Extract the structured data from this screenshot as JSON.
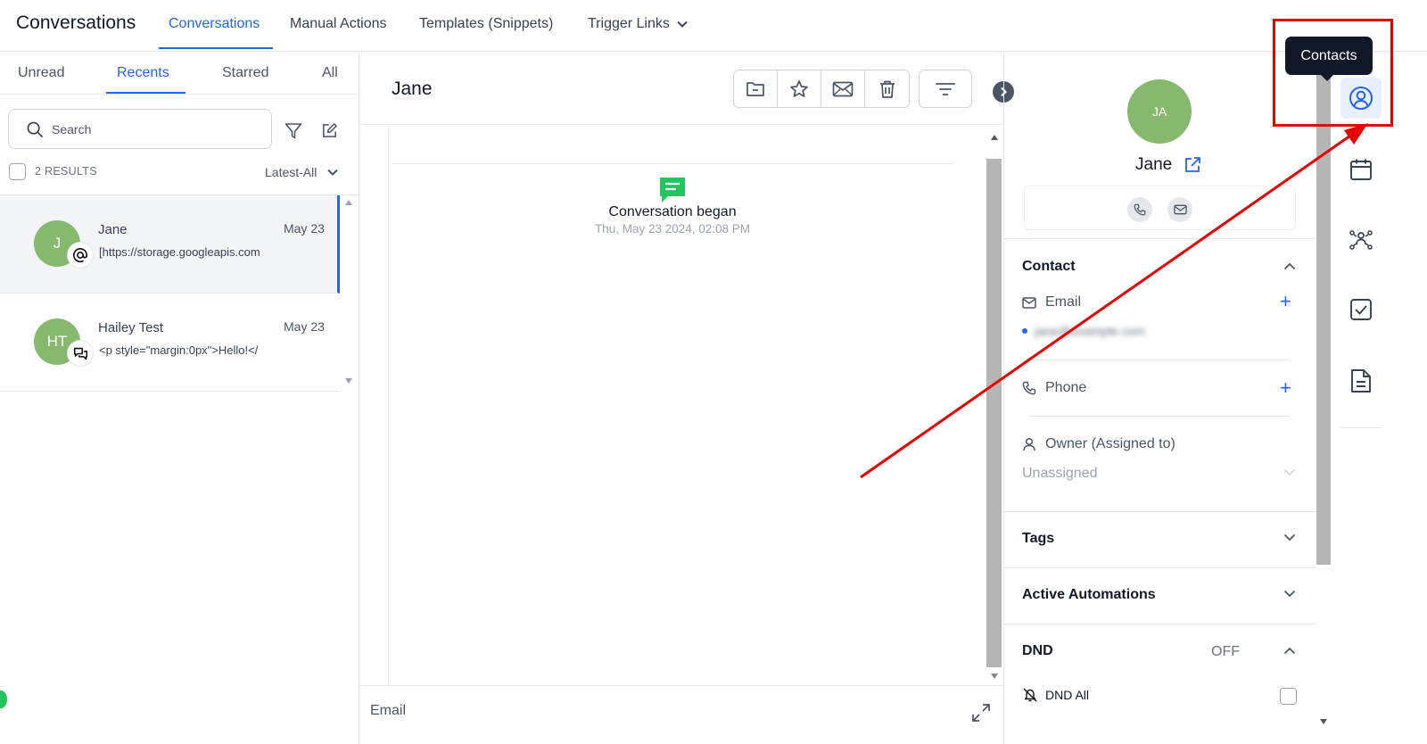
{
  "app": {
    "title": "Conversations"
  },
  "topnav": {
    "items": [
      {
        "label": "Conversations"
      },
      {
        "label": "Manual Actions"
      },
      {
        "label": "Templates (Snippets)"
      },
      {
        "label": "Trigger Links"
      }
    ]
  },
  "left": {
    "tabs": [
      {
        "label": "Unread"
      },
      {
        "label": "Recents"
      },
      {
        "label": "Starred"
      },
      {
        "label": "All"
      }
    ],
    "search": {
      "placeholder": "Search"
    },
    "results_count": "2 RESULTS",
    "sort": {
      "label": "Latest-All"
    },
    "conversations": [
      {
        "initials": "J",
        "name": "Jane",
        "preview": "[https://storage.googleapis.com",
        "date": "May 23",
        "channel_icon": "at-sign-icon"
      },
      {
        "initials": "HT",
        "name": "Hailey Test",
        "preview": "<p style=\"margin:0px\">Hello!</",
        "date": "May 23",
        "channel_icon": "chat-bubbles-icon"
      }
    ]
  },
  "thread": {
    "title": "Jane",
    "actions": [
      "folder-icon",
      "star-icon",
      "mail-icon",
      "trash-icon",
      "filter-lines-icon"
    ],
    "event": {
      "text": "Conversation began",
      "time": "Thu, May 23 2024, 02:08 PM"
    },
    "composer": {
      "channel": "Email"
    }
  },
  "contact": {
    "initials": "JA",
    "name": "Jane",
    "sections": {
      "contact": "Contact",
      "email_label": "Email",
      "email_value": "jane@example.com",
      "phone_label": "Phone",
      "owner_label": "Owner (Assigned to)",
      "owner_value": "Unassigned",
      "tags": "Tags",
      "automations": "Active Automations",
      "dnd": "DND",
      "dnd_status": "OFF",
      "dnd_all": "DND All"
    }
  },
  "rail": {
    "items": [
      "contacts-icon",
      "calendar-icon",
      "opportunities-icon",
      "tasks-icon",
      "documents-icon"
    ]
  },
  "tooltip": {
    "text": "Contacts"
  },
  "colors": {
    "accent": "#2563eb",
    "avatar": "#86b86e",
    "annotation": "#e60000",
    "message_icon": "#22c55e"
  }
}
